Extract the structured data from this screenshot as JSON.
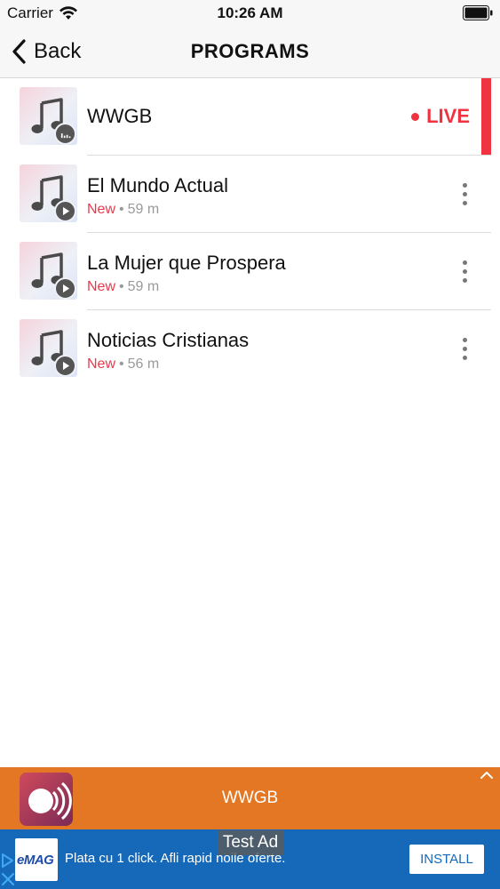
{
  "status_bar": {
    "carrier": "Carrier",
    "time": "10:26 AM"
  },
  "nav": {
    "back_label": "Back",
    "title": "PROGRAMS"
  },
  "programs": [
    {
      "title": "WWGB",
      "status": "LIVE",
      "icon": "music-note-icon",
      "badge": "equalizer-icon"
    },
    {
      "title": "El Mundo Actual",
      "tag": "New",
      "duration": "59 m",
      "icon": "music-note-icon",
      "badge": "play-icon"
    },
    {
      "title": "La Mujer que Prospera",
      "tag": "New",
      "duration": "59 m",
      "icon": "music-note-icon",
      "badge": "play-icon"
    },
    {
      "title": "Noticias Cristianas",
      "tag": "New",
      "duration": "56 m",
      "icon": "music-note-icon",
      "badge": "play-icon"
    }
  ],
  "meta_separator": "•",
  "player": {
    "title": "WWGB"
  },
  "ad": {
    "tag": "Test Ad",
    "brand": "eMAG",
    "text": "Plata cu 1 click. Afli rapid noile oferte.",
    "cta": "INSTALL"
  },
  "colors": {
    "accent_red": "#ef3340",
    "new_red": "#e8394b",
    "player_orange": "#e37724",
    "ad_blue": "#1668b8"
  }
}
